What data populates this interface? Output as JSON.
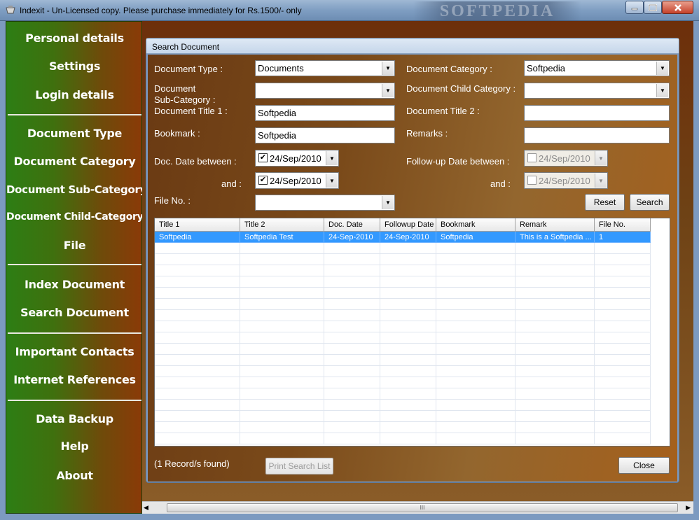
{
  "window": {
    "title": "Indexit - Un-Licensed copy. Please purchase immediately for Rs.1500/- only",
    "watermark": "SOFTPEDIA"
  },
  "sidebar": {
    "groups": [
      [
        "Personal details",
        "Settings",
        "Login details"
      ],
      [
        "Document Type",
        "Document Category",
        "Document Sub-Category",
        "Document Child-Category",
        "File"
      ],
      [
        "Index Document",
        "Search Document"
      ],
      [
        "Important Contacts",
        "Internet References"
      ],
      [
        "Data Backup",
        "Help",
        "About"
      ]
    ]
  },
  "dialog": {
    "title": "Search Document",
    "labels": {
      "doc_type": "Document Type :",
      "doc_category": "Document Category :",
      "doc_subcat": "Document\nSub-Category :",
      "doc_child": "Document Child Category :",
      "title1": "Document Title 1 :",
      "title2": "Document Title 2 :",
      "bookmark": "Bookmark :",
      "remarks": "Remarks :",
      "doc_date_between": "Doc. Date between :",
      "and1": "and :",
      "followup_between": "Follow-up Date between :",
      "and2": "and :",
      "file_no": "File No. :"
    },
    "values": {
      "doc_type": "Documents",
      "doc_category": "Softpedia",
      "doc_subcat": "",
      "doc_child": "",
      "title1": "Softpedia",
      "title2": "",
      "bookmark": "Softpedia",
      "remarks": "",
      "doc_date_from": "24/Sep/2010",
      "doc_date_to": "24/Sep/2010",
      "followup_from": "24/Sep/2010",
      "followup_to": "24/Sep/2010",
      "file_no": ""
    },
    "checked": {
      "doc_date_from": "✔",
      "doc_date_to": "✔"
    },
    "buttons": {
      "reset": "Reset",
      "search": "Search",
      "print": "Print Search List",
      "close": "Close"
    },
    "status": "(1 Record/s found)",
    "grid": {
      "columns": [
        "Title 1",
        "Title 2",
        "Doc. Date",
        "Followup Date",
        "Bookmark",
        "Remark",
        "File No."
      ],
      "rows": [
        [
          "Softpedia",
          "Softpedia Test",
          "24-Sep-2010",
          "24-Sep-2010",
          "Softpedia",
          "This is a Softpedia ...",
          "1"
        ]
      ]
    }
  },
  "scrollbar": {
    "left_arrow": "◀",
    "right_arrow": "▶",
    "grip": "III"
  },
  "icons": {
    "dropdown": "▼",
    "minimize": "–",
    "maximize": "□",
    "close": "✕"
  }
}
